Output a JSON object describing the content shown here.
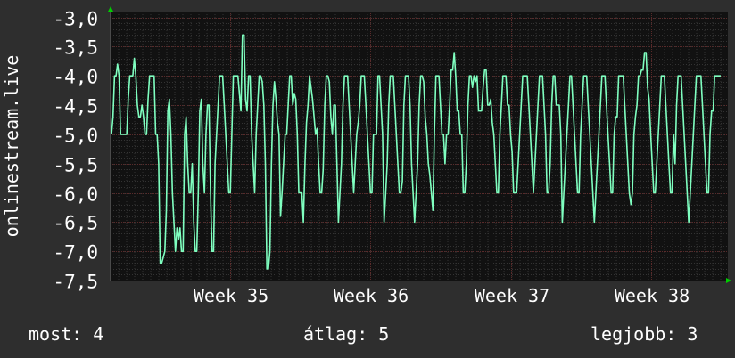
{
  "chart_data": {
    "type": "line",
    "ylabel": "onlinestream.live",
    "ylim": [
      -7.5,
      -2.9
    ],
    "y_ticks": [
      "-3,0",
      "-3,5",
      "-4,0",
      "-4,5",
      "-5,0",
      "-5,5",
      "-6,0",
      "-6,5",
      "-7,0",
      "-7,5"
    ],
    "x_ticks": [
      "Week 35",
      "Week 36",
      "Week 37",
      "Week 38"
    ],
    "grid": true,
    "colors": {
      "background": "#2e2e2e",
      "plot_background": "#111111",
      "major_grid": "#5a2a2a",
      "minor_grid": "#333333",
      "line": "#7fffc0",
      "axis_arrow": "#00cc00"
    },
    "series": [
      {
        "values": [
          -5.0,
          -4.7,
          -4.0,
          -4.0,
          -3.8,
          -4.0,
          -5.0,
          -5.0,
          -5.0,
          -5.0,
          -5.0,
          -4.4,
          -4.0,
          -4.0,
          -4.0,
          -3.7,
          -4.0,
          -4.5,
          -4.7,
          -4.7,
          -4.5,
          -4.7,
          -5.0,
          -5.0,
          -4.4,
          -4.0,
          -4.0,
          -4.0,
          -4.0,
          -5.0,
          -5.0,
          -5.5,
          -7.2,
          -7.2,
          -7.1,
          -7.0,
          -6.3,
          -4.6,
          -4.4,
          -5.0,
          -6.0,
          -6.5,
          -7.0,
          -6.6,
          -6.8,
          -6.6,
          -7.0,
          -7.0,
          -5.0,
          -4.7,
          -5.5,
          -6.0,
          -6.0,
          -5.5,
          -6.5,
          -7.0,
          -7.0,
          -6.0,
          -4.6,
          -4.4,
          -5.5,
          -6.0,
          -5.0,
          -4.5,
          -4.5,
          -6.0,
          -7.0,
          -7.0,
          -5.5,
          -5.0,
          -4.5,
          -4.0,
          -4.0,
          -4.0,
          -4.5,
          -5.0,
          -5.5,
          -6.0,
          -6.0,
          -5.0,
          -4.0,
          -4.0,
          -4.0,
          -4.0,
          -4.3,
          -4.6,
          -3.3,
          -3.3,
          -4.4,
          -4.6,
          -4.0,
          -4.0,
          -5.0,
          -5.5,
          -6.0,
          -5.0,
          -4.5,
          -4.0,
          -4.0,
          -4.1,
          -4.5,
          -5.5,
          -7.3,
          -7.3,
          -7.0,
          -5.5,
          -4.5,
          -4.1,
          -4.4,
          -4.8,
          -5.0,
          -6.4,
          -6.0,
          -5.5,
          -5.0,
          -5.0,
          -4.5,
          -4.0,
          -4.0,
          -4.5,
          -4.3,
          -4.4,
          -5.0,
          -6.0,
          -6.0,
          -6.0,
          -6.5,
          -5.5,
          -4.8,
          -4.5,
          -4.0,
          -4.2,
          -4.4,
          -4.7,
          -5.0,
          -4.9,
          -5.5,
          -6.0,
          -6.0,
          -5.6,
          -4.5,
          -4.0,
          -4.0,
          -4.1,
          -4.7,
          -5.0,
          -4.5,
          -4.5,
          -5.5,
          -6.5,
          -6.0,
          -5.5,
          -4.5,
          -4.0,
          -4.0,
          -4.0,
          -4.5,
          -5.0,
          -5.5,
          -6.0,
          -5.5,
          -5.0,
          -4.8,
          -4.5,
          -4.0,
          -4.0,
          -4.0,
          -4.5,
          -5.0,
          -5.5,
          -6.0,
          -6.0,
          -5.0,
          -5.0,
          -5.0,
          -4.0,
          -4.0,
          -4.5,
          -5.0,
          -6.5,
          -6.0,
          -5.5,
          -4.5,
          -4.0,
          -4.0,
          -4.0,
          -4.5,
          -5.0,
          -5.5,
          -6.0,
          -6.0,
          -5.8,
          -4.5,
          -4.0,
          -4.0,
          -4.0,
          -4.5,
          -5.5,
          -6.0,
          -6.5,
          -6.0,
          -5.5,
          -4.5,
          -4.0,
          -4.0,
          -4.1,
          -4.7,
          -5.0,
          -5.5,
          -5.7,
          -6.0,
          -6.3,
          -5.0,
          -4.0,
          -4.0,
          -4.0,
          -4.5,
          -5.0,
          -5.0,
          -5.5,
          -5.0,
          -5.0,
          -4.5,
          -3.9,
          -3.9,
          -3.6,
          -4.0,
          -4.6,
          -4.6,
          -5.0,
          -5.0,
          -6.0,
          -6.0,
          -5.5,
          -4.5,
          -4.0,
          -4.0,
          -4.2,
          -4.0,
          -4.1,
          -4.0,
          -4.6,
          -4.6,
          -4.6,
          -4.2,
          -3.9,
          -3.9,
          -4.5,
          -4.5,
          -4.4,
          -4.8,
          -5.0,
          -5.5,
          -6.0,
          -6.0,
          -5.0,
          -4.5,
          -4.0,
          -4.0,
          -4.0,
          -4.5,
          -4.5,
          -5.0,
          -5.3,
          -6.0,
          -6.0,
          -6.0,
          -5.5,
          -5.0,
          -4.5,
          -4.0,
          -4.0,
          -4.0,
          -4.0,
          -4.5,
          -5.0,
          -5.5,
          -6.0,
          -5.5,
          -5.0,
          -4.5,
          -4.0,
          -4.0,
          -4.0,
          -4.5,
          -5.0,
          -6.0,
          -6.0,
          -5.5,
          -4.5,
          -4.0,
          -4.0,
          -4.5,
          -4.5,
          -4.5,
          -5.0,
          -6.5,
          -6.0,
          -5.5,
          -5.0,
          -4.5,
          -4.0,
          -4.0,
          -4.5,
          -5.0,
          -5.5,
          -6.0,
          -6.0,
          -5.0,
          -4.5,
          -4.0,
          -4.0,
          -4.0,
          -4.5,
          -5.0,
          -5.5,
          -6.0,
          -6.5,
          -6.0,
          -5.5,
          -5.0,
          -4.5,
          -4.0,
          -4.0,
          -4.0,
          -4.5,
          -5.0,
          -5.5,
          -6.0,
          -6.0,
          -5.0,
          -4.7,
          -4.7,
          -4.0,
          -4.0,
          -4.0,
          -4.0,
          -4.5,
          -5.0,
          -5.5,
          -6.0,
          -6.2,
          -6.0,
          -5.0,
          -4.7,
          -4.5,
          -4.0,
          -4.0,
          -3.9,
          -3.9,
          -3.6,
          -3.6,
          -4.2,
          -4.4,
          -5.0,
          -5.5,
          -6.0,
          -6.0,
          -5.5,
          -5.0,
          -4.5,
          -4.0,
          -4.0,
          -4.0,
          -4.5,
          -5.0,
          -5.5,
          -6.0,
          -6.0,
          -5.0,
          -5.5,
          -4.5,
          -4.0,
          -4.0,
          -4.0,
          -4.5,
          -5.0,
          -5.5,
          -6.0,
          -6.5,
          -6.0,
          -5.5,
          -5.0,
          -4.5,
          -4.0,
          -4.0,
          -4.0,
          -4.0,
          -4.5,
          -5.0,
          -5.5,
          -6.0,
          -6.0,
          -5.0,
          -4.6,
          -4.6,
          -4.0,
          -4.0,
          -4.0,
          -4.0,
          -4.0
        ],
        "color": "#7fffc0"
      }
    ]
  },
  "stats": {
    "current": "most: 4",
    "average": "átlag: 5",
    "best": "legjobb: 3"
  }
}
